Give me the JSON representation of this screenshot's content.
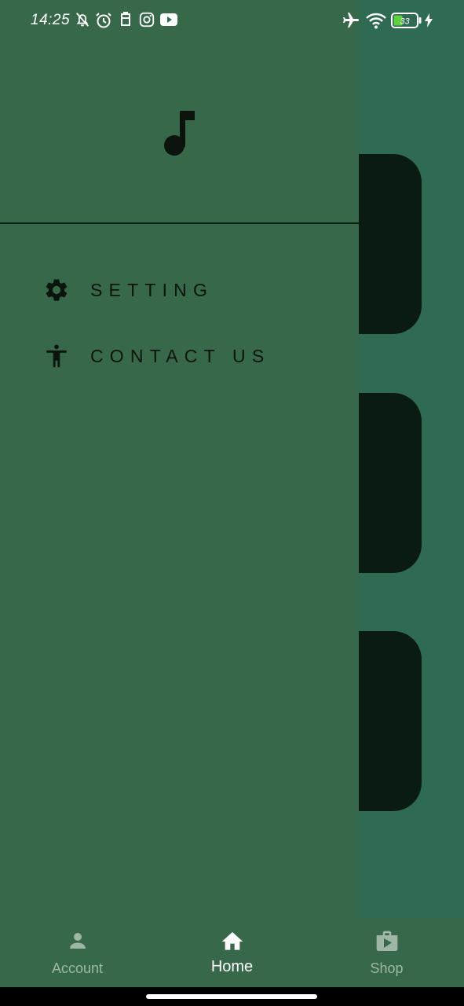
{
  "status_bar": {
    "time": "14:25",
    "battery_level": "33",
    "left_icons": [
      "bell-off-icon",
      "alarm-icon",
      "notification-icon",
      "instagram-icon",
      "youtube-icon"
    ],
    "right_icons": [
      "airplane-icon",
      "wifi-icon",
      "battery-icon",
      "charging-icon"
    ]
  },
  "drawer": {
    "header_icon": "music-note-icon",
    "items": [
      {
        "label": "SETTING",
        "icon": "gear-icon"
      },
      {
        "label": "CONTACT US",
        "icon": "accessibility-icon"
      }
    ]
  },
  "bottom_nav": {
    "items": [
      {
        "label": "Account",
        "icon": "person-icon",
        "active": false
      },
      {
        "label": "Home",
        "icon": "home-icon",
        "active": true
      },
      {
        "label": "Shop",
        "icon": "shop-icon",
        "active": false
      }
    ]
  },
  "colors": {
    "drawer_bg": "#376849",
    "page_bg": "#2f6a52",
    "card_bg": "#0a1c12",
    "text_dark": "#0b140d",
    "nav_inactive": "#9db7a4",
    "nav_active": "#ffffff"
  }
}
